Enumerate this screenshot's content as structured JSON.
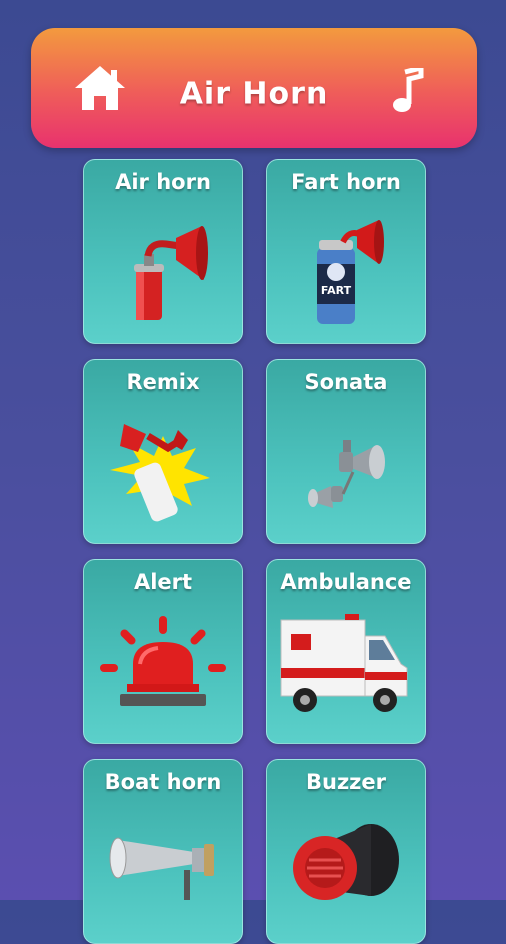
{
  "header": {
    "title": "Air Horn",
    "home_icon": "home-icon",
    "music_icon": "music-note-icon"
  },
  "sounds": [
    {
      "label": "Air horn",
      "icon": "air-horn-icon"
    },
    {
      "label": "Fart horn",
      "icon": "fart-horn-icon"
    },
    {
      "label": "Remix",
      "icon": "remix-horn-icon"
    },
    {
      "label": "Sonata",
      "icon": "sonata-horn-icon"
    },
    {
      "label": "Alert",
      "icon": "alert-siren-icon"
    },
    {
      "label": "Ambulance",
      "icon": "ambulance-icon"
    },
    {
      "label": "Boat horn",
      "icon": "boat-horn-icon"
    },
    {
      "label": "Buzzer",
      "icon": "buzzer-icon"
    }
  ],
  "colors": {
    "background": "#4a4f9e",
    "header_gradient_top": "#f39a3e",
    "header_gradient_bottom": "#e8326e",
    "card": "#4cc2bd"
  }
}
